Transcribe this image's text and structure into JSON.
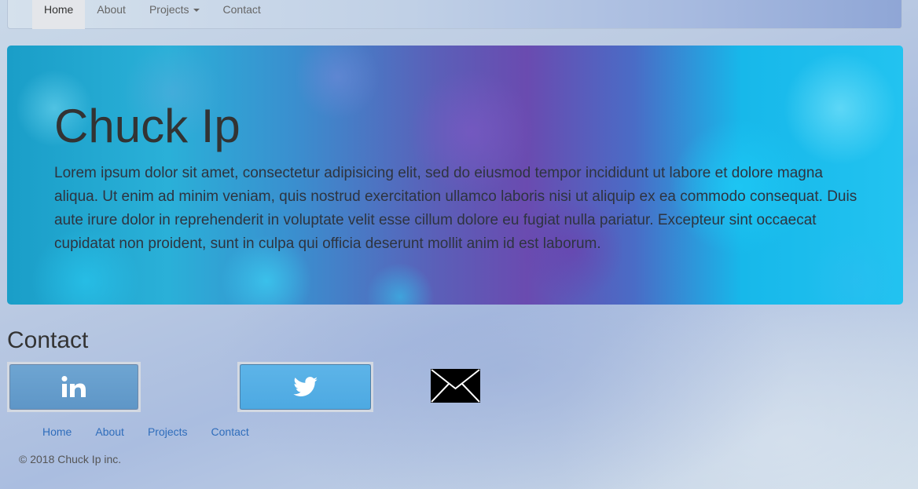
{
  "navbar": {
    "items": [
      {
        "label": "Home",
        "active": true
      },
      {
        "label": "About",
        "active": false
      },
      {
        "label": "Projects",
        "active": false,
        "dropdown": true
      },
      {
        "label": "Contact",
        "active": false
      }
    ]
  },
  "jumbotron": {
    "title": "Chuck Ip",
    "text": "Lorem ipsum dolor sit amet, consectetur adipisicing elit, sed do eiusmod tempor incididunt ut labore et dolore magna aliqua. Ut enim ad minim veniam, quis nostrud exercitation ullamco laboris nisi ut aliquip ex ea commodo consequat. Duis aute irure dolor in reprehenderit in voluptate velit esse cillum dolore eu fugiat nulla pariatur. Excepteur sint occaecat cupidatat non proident, sunt in culpa qui officia deserunt mollit anim id est laborum."
  },
  "contact": {
    "heading": "Contact",
    "buttons": [
      {
        "icon": "linkedin-icon",
        "color": "#5e96c7"
      },
      {
        "icon": "twitter-icon",
        "color": "#4da9e2"
      },
      {
        "icon": "envelope-icon",
        "color": "#000000"
      }
    ]
  },
  "footer": {
    "links": [
      "Home",
      "About",
      "Projects",
      "Contact"
    ],
    "copyright": "© 2018 Chuck Ip inc."
  },
  "colors": {
    "link": "#2f6dbb",
    "jumbotron_accent": "#22c3f0"
  }
}
